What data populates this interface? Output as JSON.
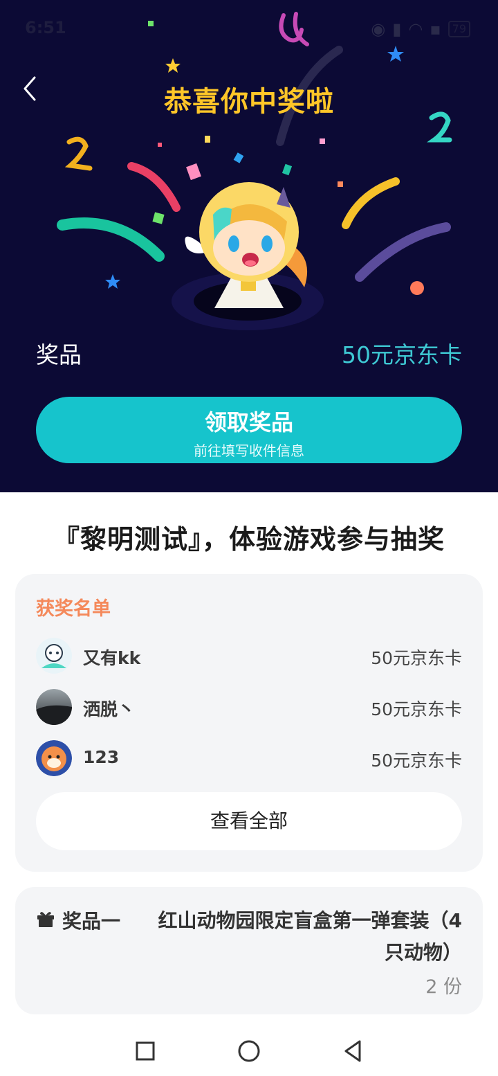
{
  "status": {
    "time": "6:51",
    "battery": "79"
  },
  "hero": {
    "title": "恭喜你中奖啦",
    "prize_label": "奖品",
    "prize_value": "50元京东卡",
    "claim_button": {
      "title": "领取奖品",
      "subtitle": "前往填写收件信息"
    }
  },
  "event_title": "『黎明测试』，体验游戏参与抽奖",
  "winners": {
    "heading": "获奖名单",
    "items": [
      {
        "name": "又有kk",
        "prize": "50元京东卡"
      },
      {
        "name": "洒脱丶",
        "prize": "50元京东卡"
      },
      {
        "name": "123",
        "prize": "50元京东卡"
      }
    ],
    "view_all": "查看全部"
  },
  "prizes": [
    {
      "index_label": "奖品一",
      "name": "红山动物园限定盲盒第一弹套装（4只动物）",
      "quantity": "2 份"
    }
  ],
  "colors": {
    "hero_bg": "#0c0a35",
    "accent_teal": "#16c4cc",
    "title_yellow": "#ffc628",
    "heading_orange": "#f4895b"
  },
  "icons": [
    "back-icon",
    "gift-icon",
    "nav-recents-icon",
    "nav-home-icon",
    "nav-back-icon"
  ]
}
